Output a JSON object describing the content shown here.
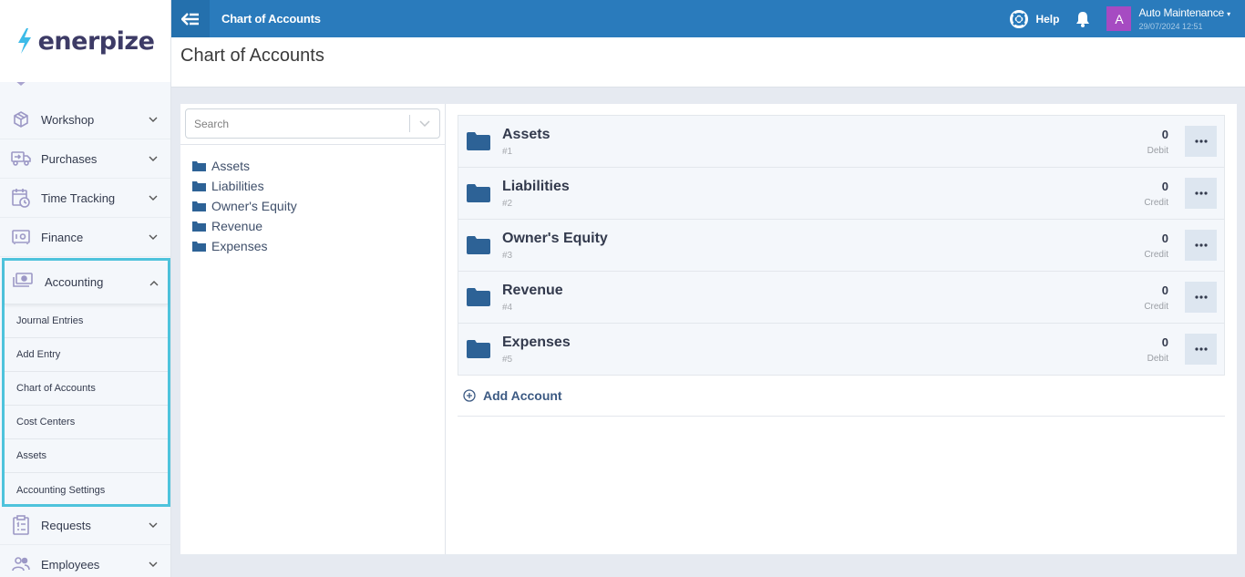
{
  "app": {
    "brand": "enerpize",
    "colors": {
      "topbar": "#2a7bbc",
      "accent_highlight": "#4ec3dc",
      "folder": "#2d6296",
      "avatar": "#a64bc2"
    }
  },
  "topbar": {
    "back_icon": "arrow-left-bars-icon",
    "title": "Chart of Accounts",
    "help_label": "Help",
    "help_icon": "lifebuoy-icon",
    "notification_icon": "bell-icon",
    "avatar_letter": "A",
    "user_name": "Auto Maintenance",
    "user_datetime": "29/07/2024 12:51"
  },
  "sidebar": {
    "items": [
      {
        "label": "Workshop",
        "icon": "box-icon"
      },
      {
        "label": "Purchases",
        "icon": "truck-icon"
      },
      {
        "label": "Time Tracking",
        "icon": "calendar-clock-icon"
      },
      {
        "label": "Finance",
        "icon": "safe-icon"
      }
    ],
    "expanded": {
      "label": "Accounting",
      "icon": "money-icon",
      "children": [
        {
          "label": "Journal Entries"
        },
        {
          "label": "Add Entry"
        },
        {
          "label": "Chart of Accounts"
        },
        {
          "label": "Cost Centers"
        },
        {
          "label": "Assets"
        },
        {
          "label": "Accounting Settings"
        }
      ]
    },
    "bottom_items": [
      {
        "label": "Requests",
        "icon": "clipboard-list-icon"
      },
      {
        "label": "Employees",
        "icon": "users-icon"
      }
    ]
  },
  "page": {
    "title": "Chart of Accounts"
  },
  "tree": {
    "search_placeholder": "Search",
    "search_value": "",
    "items": [
      {
        "label": "Assets"
      },
      {
        "label": "Liabilities"
      },
      {
        "label": "Owner's Equity"
      },
      {
        "label": "Revenue"
      },
      {
        "label": "Expenses"
      }
    ]
  },
  "accounts": [
    {
      "name": "Assets",
      "code": "#1",
      "amount": "0",
      "type": "Debit"
    },
    {
      "name": "Liabilities",
      "code": "#2",
      "amount": "0",
      "type": "Credit"
    },
    {
      "name": "Owner's Equity",
      "code": "#3",
      "amount": "0",
      "type": "Credit"
    },
    {
      "name": "Revenue",
      "code": "#4",
      "amount": "0",
      "type": "Credit"
    },
    {
      "name": "Expenses",
      "code": "#5",
      "amount": "0",
      "type": "Debit"
    }
  ],
  "add_account_label": "Add Account"
}
